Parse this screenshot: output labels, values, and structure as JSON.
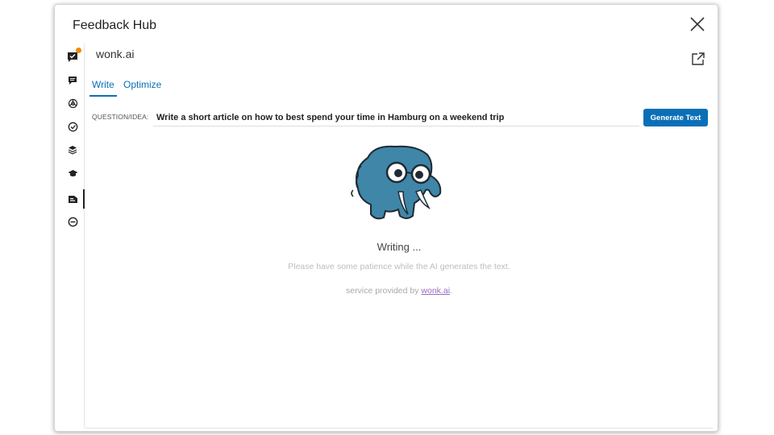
{
  "modal": {
    "title": "Feedback Hub",
    "close_icon": "close-icon"
  },
  "sidebar": {
    "items": [
      {
        "icon": "feedback-check-icon",
        "has_notification": true
      },
      {
        "icon": "chat-bubble-icon"
      },
      {
        "icon": "openai-icon"
      },
      {
        "icon": "checklist-icon"
      },
      {
        "icon": "layers-icon"
      },
      {
        "icon": "graduation-cap-icon"
      },
      {
        "icon": "wonk-writing-icon",
        "active": true
      },
      {
        "icon": "circle-minus-icon"
      }
    ]
  },
  "app": {
    "name": "wonk.ai",
    "popout_icon": "external-link-icon"
  },
  "tabs": [
    {
      "label": "Write",
      "active": true
    },
    {
      "label": "Optimize",
      "active": false
    }
  ],
  "form": {
    "question_label": "QUESTION/IDEA:",
    "question_value": "Write a short article on how to best spend your time in Hamburg on a weekend trip",
    "generate_label": "Generate Text"
  },
  "status": {
    "title": "Writing ...",
    "message": "Please have some patience while the AI generates the text.",
    "service_prefix": "service provided by ",
    "service_link": "wonk.ai",
    "service_suffix": "."
  },
  "colors": {
    "accent": "#0b6fb8",
    "notification": "#f08a00",
    "mascot": "#3f86a8",
    "link": "#9a6bc2"
  }
}
